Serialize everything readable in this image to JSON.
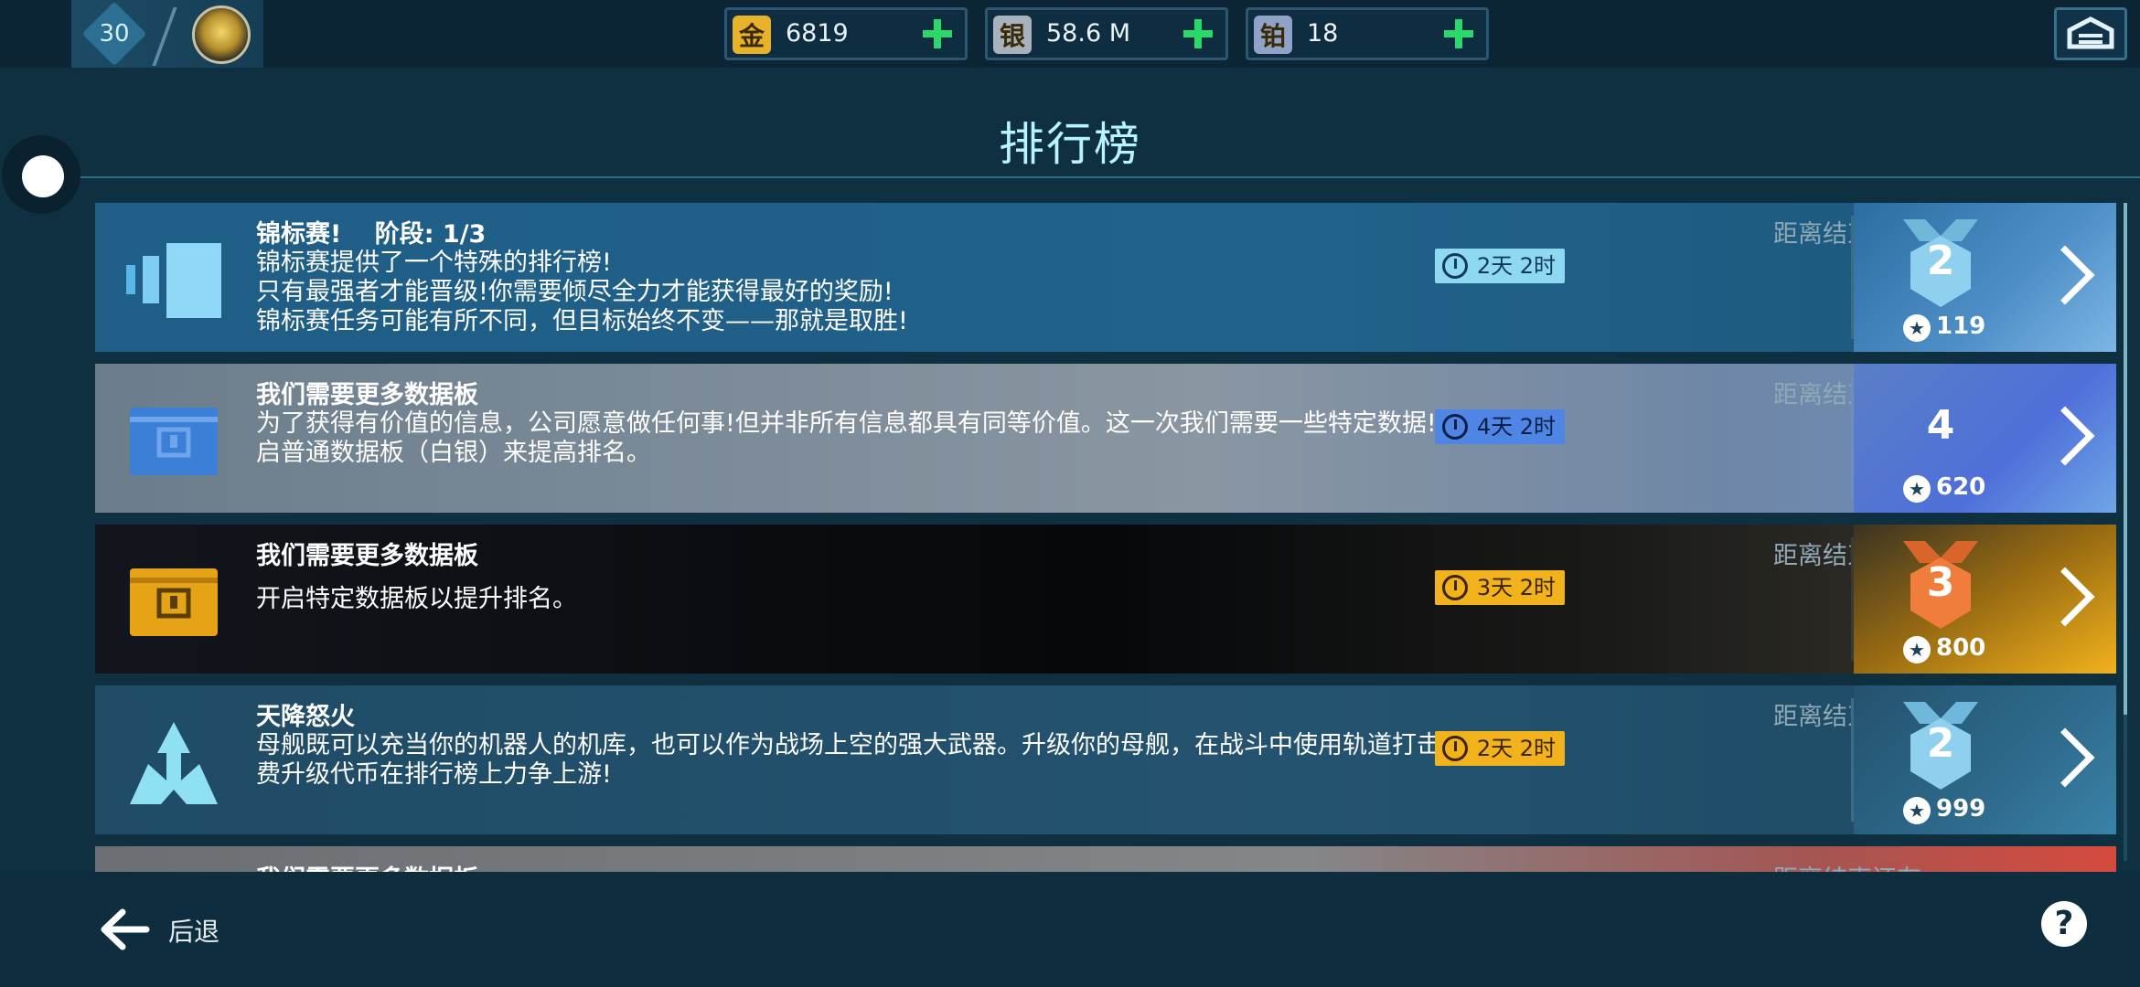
{
  "topbar": {
    "level": "30",
    "currencies": [
      {
        "icon_char": "金",
        "icon_name": "gold-icon",
        "icon_color": "#e8b22a",
        "value": "6819"
      },
      {
        "icon_char": "银",
        "icon_name": "silver-icon",
        "icon_color": "#a8b2bc",
        "value": "58.6 M"
      },
      {
        "icon_char": "铂",
        "icon_name": "platinum-icon",
        "icon_color": "#8fa3c8",
        "value": "18"
      }
    ]
  },
  "page_title": "排行榜",
  "cards": [
    {
      "title": "锦标赛!　 阶段: 1/3",
      "description": "锦标赛提供了一个特殊的排行榜!\n只有最强者才能晋级!你需要倾尽全力才能获得最好的奖励!\n锦标赛任务可能有所不同，但目标始终不变——那就是取胜!",
      "timer_label": "距离结束还有",
      "timer": "2天 2时",
      "timer_bg": "#8fd8f2",
      "timer_fg": "#0e3a58",
      "rank": "2",
      "rank_style": "silver-medal",
      "points": "119"
    },
    {
      "title": "我们需要更多数据板",
      "description": "为了获得有价值的信息，公司愿意做任何事!但并非所有信息都具有同等价值。这一次我们需要一些特定数据!开\n启普通数据板（白银）来提高排名。",
      "timer_label": "距离结束还有",
      "timer": "4天 2时",
      "timer_bg": "#4f86e6",
      "timer_fg": "#0a1e44",
      "rank": "4",
      "rank_style": "plain",
      "points": "620"
    },
    {
      "title": "我们需要更多数据板",
      "description": "开启特定数据板以提升排名。",
      "timer_label": "距离结束还有",
      "timer": "3天 2时",
      "timer_bg": "#f2b21c",
      "timer_fg": "#3a2400",
      "rank": "3",
      "rank_style": "bronze-medal",
      "points": "800"
    },
    {
      "title": "天降怒火",
      "description": "母舰既可以充当你的机器人的机库，也可以作为战场上空的强大武器。升级你的母舰，在战斗中使用轨道打击并花\n费升级代币在排行榜上力争上游!",
      "timer_label": "距离结束还有",
      "timer": "2天 2时",
      "timer_bg": "#f2b21c",
      "timer_fg": "#3a2400",
      "rank": "2",
      "rank_style": "silver-medal",
      "points": "999"
    },
    {
      "title": "我们需要更多数据板",
      "timer_label": "距离结束还有"
    }
  ],
  "bottombar": {
    "back_label": "后退",
    "help_label": "?"
  },
  "colors": {
    "accent_green": "#2bd96a",
    "title_cyan": "#b8f4ff",
    "silver_medal": "#8fd0ee",
    "bronze_medal": "#f07d3c"
  }
}
